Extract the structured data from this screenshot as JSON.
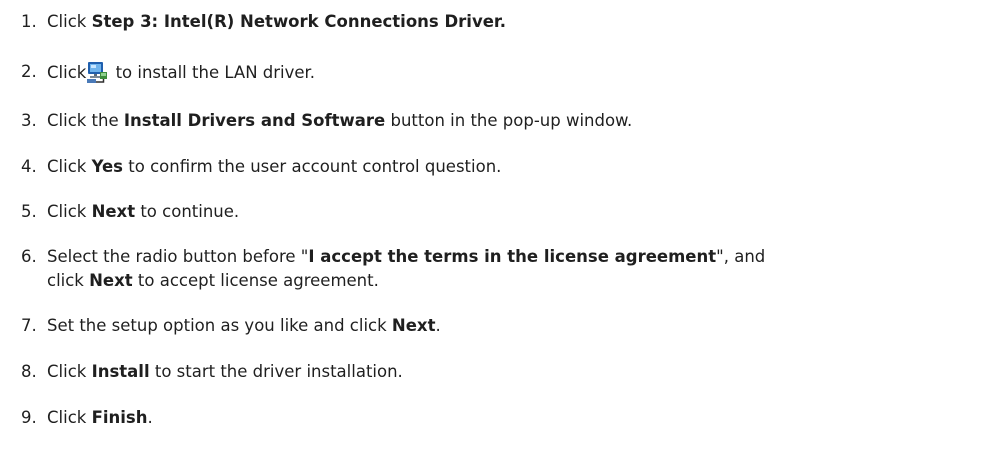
{
  "steps": [
    {
      "num": "1.",
      "parts": [
        "Click ",
        "Step 3: Intel(R) Network Connections Driver.",
        ""
      ]
    },
    {
      "num": "2.",
      "before": "Click",
      "icon": "lan-driver-icon",
      "after": " to install the LAN driver."
    },
    {
      "num": "3.",
      "parts": [
        "Click the ",
        "Install Drivers and Software",
        " button in the pop-up window."
      ]
    },
    {
      "num": "4.",
      "parts": [
        "Click ",
        "Yes",
        " to confirm the user account control question."
      ]
    },
    {
      "num": "5.",
      "parts": [
        "Click ",
        "Next",
        " to continue."
      ]
    },
    {
      "num": "6.",
      "line1": [
        "Select the radio button before \"",
        "I accept the terms in the license agreement",
        "\", and"
      ],
      "line2": [
        "click ",
        "Next",
        " to accept license agreement."
      ]
    },
    {
      "num": "7.",
      "parts": [
        "Set the setup option as you like and click ",
        "Next",
        "."
      ]
    },
    {
      "num": "8.",
      "parts": [
        "Click ",
        "Install",
        " to start the driver installation."
      ]
    },
    {
      "num": "9.",
      "parts": [
        "Click ",
        "Finish",
        "."
      ]
    }
  ]
}
